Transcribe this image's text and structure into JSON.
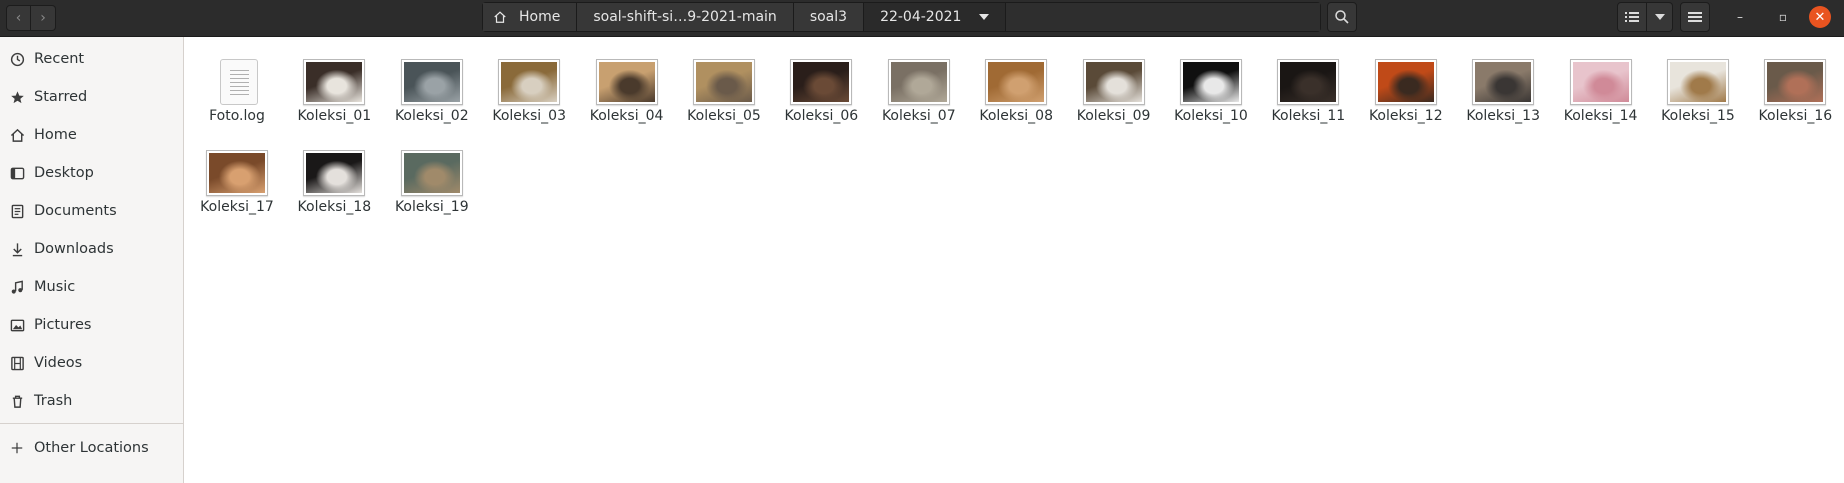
{
  "header": {
    "back_label": "‹",
    "forward_label": "›",
    "breadcrumbs": [
      "Home",
      "soal-shift-si…9-2021-main",
      "soal3",
      "22-04-2021"
    ],
    "window_controls": {
      "minimize": "–",
      "maximize": "▫",
      "close": "✕"
    }
  },
  "sidebar": {
    "items": [
      {
        "label": "Recent",
        "icon": "clock-icon"
      },
      {
        "label": "Starred",
        "icon": "star-icon"
      },
      {
        "label": "Home",
        "icon": "home-icon"
      },
      {
        "label": "Desktop",
        "icon": "desktop-icon"
      },
      {
        "label": "Documents",
        "icon": "documents-icon"
      },
      {
        "label": "Downloads",
        "icon": "download-icon"
      },
      {
        "label": "Music",
        "icon": "music-icon"
      },
      {
        "label": "Pictures",
        "icon": "pictures-icon"
      },
      {
        "label": "Videos",
        "icon": "videos-icon"
      },
      {
        "label": "Trash",
        "icon": "trash-icon"
      }
    ],
    "other_locations": {
      "label": "Other Locations",
      "icon": "plus-icon"
    }
  },
  "files": [
    {
      "name": "Foto.log",
      "type": "text"
    },
    {
      "name": "Koleksi_01",
      "type": "image",
      "colors": [
        "#3a2e28",
        "#e8e4dd"
      ]
    },
    {
      "name": "Koleksi_02",
      "type": "image",
      "colors": [
        "#4a5458",
        "#9aa2a6"
      ]
    },
    {
      "name": "Koleksi_03",
      "type": "image",
      "colors": [
        "#8a6a3a",
        "#d8cfc0"
      ]
    },
    {
      "name": "Koleksi_04",
      "type": "image",
      "colors": [
        "#c8a070",
        "#4a3a2c"
      ]
    },
    {
      "name": "Koleksi_05",
      "type": "image",
      "colors": [
        "#b09060",
        "#6a5a4a"
      ]
    },
    {
      "name": "Koleksi_06",
      "type": "image",
      "colors": [
        "#2a1e1a",
        "#6a4a36"
      ]
    },
    {
      "name": "Koleksi_07",
      "type": "image",
      "colors": [
        "#7a7064",
        "#b0a898"
      ]
    },
    {
      "name": "Koleksi_08",
      "type": "image",
      "colors": [
        "#a06a34",
        "#d0a070"
      ]
    },
    {
      "name": "Koleksi_09",
      "type": "image",
      "colors": [
        "#5a4a38",
        "#e4e0da"
      ]
    },
    {
      "name": "Koleksi_10",
      "type": "image",
      "colors": [
        "#101010",
        "#e8e8e8"
      ]
    },
    {
      "name": "Koleksi_11",
      "type": "image",
      "colors": [
        "#1a1614",
        "#3a302a"
      ]
    },
    {
      "name": "Koleksi_12",
      "type": "image",
      "colors": [
        "#c04a18",
        "#3a2a20"
      ]
    },
    {
      "name": "Koleksi_13",
      "type": "image",
      "colors": [
        "#8a7a6a",
        "#3a3634"
      ]
    },
    {
      "name": "Koleksi_14",
      "type": "image",
      "colors": [
        "#e8c4cc",
        "#d08a98"
      ]
    },
    {
      "name": "Koleksi_15",
      "type": "image",
      "colors": [
        "#e8e4dc",
        "#a07a4a"
      ]
    },
    {
      "name": "Koleksi_16",
      "type": "image",
      "colors": [
        "#6a5a4a",
        "#b07058"
      ]
    },
    {
      "name": "Koleksi_17",
      "type": "image",
      "colors": [
        "#7a4a2a",
        "#d8a070"
      ]
    },
    {
      "name": "Koleksi_18",
      "type": "image",
      "colors": [
        "#1a1818",
        "#e4e0dc"
      ]
    },
    {
      "name": "Koleksi_19",
      "type": "image",
      "colors": [
        "#5a6a60",
        "#a08a6a"
      ]
    }
  ]
}
